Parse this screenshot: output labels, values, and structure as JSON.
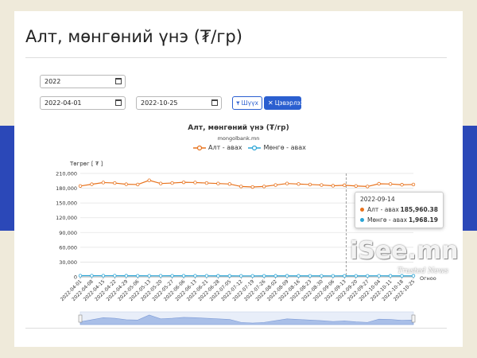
{
  "page": {
    "title": "Алт, мөнгөний үнэ (₮/гр)"
  },
  "filters": {
    "year": "2022",
    "date_from": "2022-04-01",
    "date_to": "2022-10-25",
    "filter_label": "Шүүх",
    "clear_label": "Цэвэрлэх"
  },
  "tooltip": {
    "date": "2022-09-14",
    "gold_label": "Алт - авах",
    "gold_value": "185,960.38",
    "silver_label": "Мөнгө - авах",
    "silver_value": "1,968.19"
  },
  "watermark": {
    "main": "iSee.mn",
    "sub": "Trusted News"
  },
  "colors": {
    "gold": "#e8721c",
    "silver": "#2aa5d6",
    "accent": "#2b5fd0"
  },
  "chart_data": {
    "type": "line",
    "title": "Алт, мөнгөний үнэ (₮/гр)",
    "subtitle": "mongolbank.mn",
    "ylabel": "Төгрөг [ ₮ ]",
    "xlabel": "Огноо",
    "ylim": [
      0,
      210000
    ],
    "yticks": [
      "0",
      "30,000",
      "60,000",
      "90,000",
      "120,000",
      "150,000",
      "180,000",
      "210,000"
    ],
    "categories": [
      "2022-04-01",
      "2022-04-08",
      "2022-04-15",
      "2022-04-22",
      "2022-04-29",
      "2022-05-06",
      "2022-05-13",
      "2022-05-20",
      "2022-05-27",
      "2022-06-06",
      "2022-06-13",
      "2022-06-21",
      "2022-06-28",
      "2022-07-05",
      "2022-07-12",
      "2022-07-19",
      "2022-07-26",
      "2022-08-02",
      "2022-08-09",
      "2022-08-16",
      "2022-08-23",
      "2022-08-30",
      "2022-09-06",
      "2022-09-13",
      "2022-09-20",
      "2022-09-27",
      "2022-10-04",
      "2022-10-11",
      "2022-10-18",
      "2022-10-25"
    ],
    "series": [
      {
        "name": "Алт - авах",
        "values": [
          184500,
          188000,
          191500,
          190500,
          188000,
          187500,
          196000,
          189500,
          190500,
          192000,
          191500,
          190500,
          189500,
          188500,
          183500,
          182500,
          183500,
          186500,
          189500,
          188500,
          187500,
          186500,
          185000,
          186000,
          184500,
          183500,
          189000,
          188500,
          187000,
          187500
        ]
      },
      {
        "name": "Мөнгө - авах",
        "values": [
          2400,
          2380,
          2350,
          2300,
          2250,
          2200,
          2150,
          2150,
          2180,
          2180,
          2150,
          2100,
          2050,
          2000,
          1950,
          1950,
          1960,
          2000,
          2050,
          2000,
          1980,
          1960,
          1950,
          1968,
          1970,
          1990,
          2100,
          2050,
          2000,
          2050
        ]
      }
    ],
    "highlight": {
      "date": "2022-09-14",
      "gold": 185960.38,
      "silver": 1968.19
    },
    "grid": true,
    "legend": "top-center"
  }
}
